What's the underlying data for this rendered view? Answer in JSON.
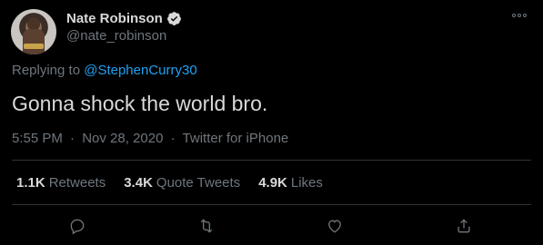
{
  "tweet": {
    "display_name": "Nate Robinson",
    "handle": "@nate_robinson",
    "replying_prefix": "Replying to",
    "replying_to": "@StephenCurry30",
    "text": "Gonna shock the world bro.",
    "time": "5:55 PM",
    "date": "Nov 28, 2020",
    "source": "Twitter for iPhone",
    "separator": "·"
  },
  "stats": [
    {
      "value": "1.1K",
      "label": "Retweets"
    },
    {
      "value": "3.4K",
      "label": "Quote Tweets"
    },
    {
      "value": "4.9K",
      "label": "Likes"
    }
  ],
  "icons": {
    "verified": "verified-badge-icon",
    "more": "more-options-icon",
    "reply": "reply-icon",
    "retweet": "retweet-icon",
    "like": "like-icon",
    "share": "share-icon"
  },
  "colors": {
    "background": "#000000",
    "text": "#d9d9d9",
    "muted": "#6e767d",
    "link": "#1da1f2",
    "divider": "#2f3336"
  }
}
